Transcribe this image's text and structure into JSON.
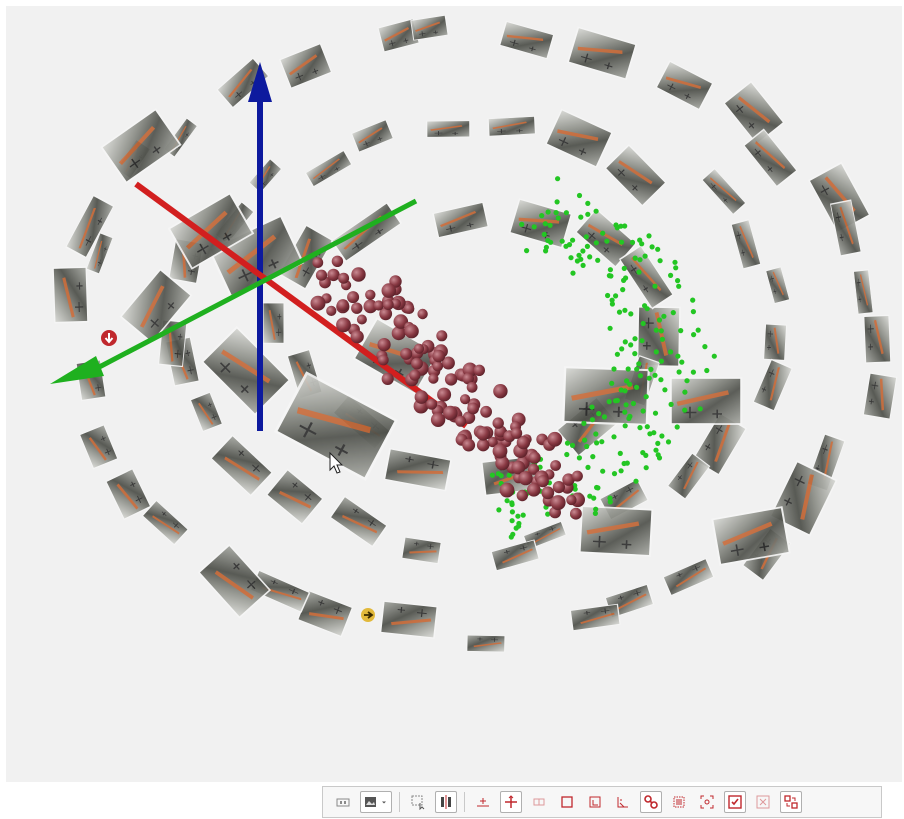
{
  "viewer": {
    "background": "#f1f1f1",
    "axes": {
      "x_color": "#d21f1f",
      "y_color": "#1fb01f",
      "z_color": "#0d1a9e"
    },
    "sparse_point_color": "#23c623",
    "camera_sphere_color": "#8a3a44",
    "marker_down": {
      "icon": "down-arrow-circle-icon",
      "color": "#c0282d"
    },
    "marker_right": {
      "icon": "right-arrow-circle-icon",
      "color": "#e2b93b"
    }
  },
  "toolbar": {
    "accent": "#c0282d",
    "items": [
      {
        "name": "view-mode-button",
        "icon": "view-mode-icon"
      },
      {
        "name": "image-display-dropdown",
        "icon": "image-icon"
      },
      {
        "name": "selection-tool-button",
        "icon": "select-rect-icon"
      },
      {
        "name": "align-tool-button",
        "icon": "align-icon"
      },
      {
        "name": "add-marker-button",
        "icon": "add-marker-icon"
      },
      {
        "name": "move-marker-button",
        "icon": "move-marker-icon"
      },
      {
        "name": "reference-button",
        "icon": "reference-icon"
      },
      {
        "name": "bounding-box-button",
        "icon": "bounding-box-icon"
      },
      {
        "name": "crop-button",
        "icon": "crop-icon"
      },
      {
        "name": "ruler-button",
        "icon": "ruler-icon"
      },
      {
        "name": "link-button",
        "icon": "link-icon"
      },
      {
        "name": "grid-select-button",
        "icon": "grid-select-icon"
      },
      {
        "name": "focus-button",
        "icon": "focus-icon"
      },
      {
        "name": "enable-button",
        "icon": "check-box-icon"
      },
      {
        "name": "disable-button",
        "icon": "x-box-icon"
      },
      {
        "name": "transform-button",
        "icon": "transform-icon"
      }
    ]
  }
}
